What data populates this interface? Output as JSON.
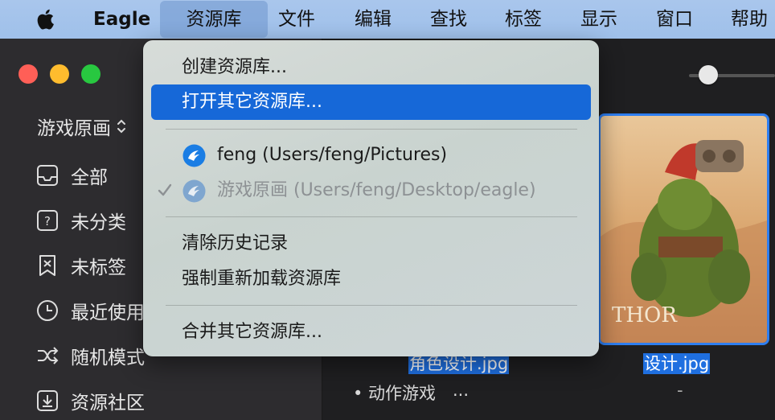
{
  "menubar": {
    "app_name": "Eagle",
    "items": [
      "资源库",
      "文件",
      "编辑",
      "查找",
      "标签",
      "显示",
      "窗口",
      "帮助"
    ],
    "active_item": "资源库"
  },
  "sidebar": {
    "library_name": "游戏原画",
    "nav": [
      {
        "label": "全部",
        "icon": "inbox-icon"
      },
      {
        "label": "未分类",
        "icon": "question-box-icon"
      },
      {
        "label": "未标签",
        "icon": "untagged-icon"
      },
      {
        "label": "最近使用",
        "icon": "clock-icon"
      },
      {
        "label": "随机模式",
        "icon": "shuffle-icon"
      },
      {
        "label": "资源社区",
        "icon": "download-box-icon"
      }
    ]
  },
  "content": {
    "files": [
      {
        "name": "角色设计.jpg",
        "meta": "• 动作游戏",
        "more": "..."
      },
      {
        "name": "设计.jpg",
        "meta": "-"
      }
    ],
    "thumbnail_text": "THOR"
  },
  "dropdown": {
    "create": "创建资源库...",
    "open_other": "打开其它资源库...",
    "libraries": [
      {
        "label": "feng (Users/feng/Pictures)",
        "checked": false
      },
      {
        "label": "游戏原画 (Users/feng/Desktop/eagle)",
        "checked": true
      }
    ],
    "clear_history": "清除历史记录",
    "force_reload": "强制重新加载资源库",
    "merge": "合并其它资源库..."
  },
  "colors": {
    "menubar": "#a9c6ec",
    "highlight": "#1668d8",
    "selection_border": "#2e7ef0",
    "traffic_red": "#ff5f57",
    "traffic_yellow": "#febc2e",
    "traffic_green": "#28c840"
  }
}
